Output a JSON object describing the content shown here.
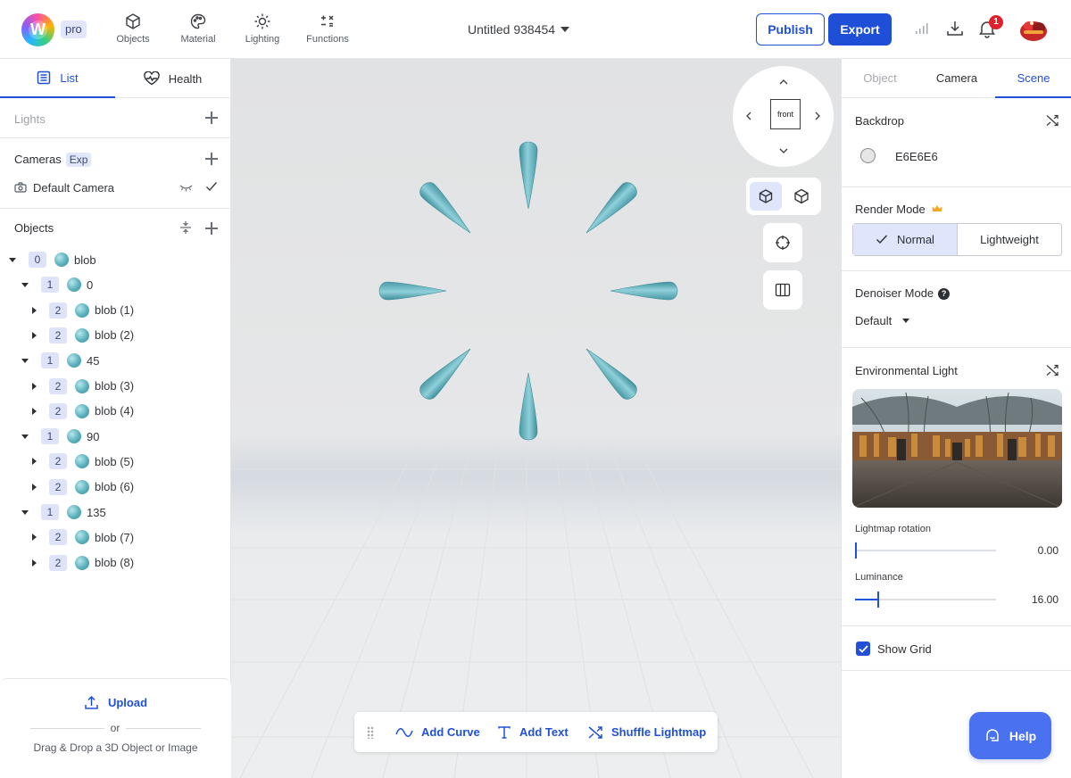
{
  "app": {
    "plan_badge": "pro",
    "logo_letter": "W",
    "document_title": "Untitled 938454"
  },
  "toolbar": {
    "tools": [
      {
        "label": "Objects",
        "icon": "cube-icon"
      },
      {
        "label": "Material",
        "icon": "palette-icon"
      },
      {
        "label": "Lighting",
        "icon": "sun-icon"
      },
      {
        "label": "Functions",
        "icon": "functions-icon"
      }
    ],
    "publish_label": "Publish",
    "export_label": "Export",
    "notification_count": "1"
  },
  "left_panel": {
    "tabs": [
      {
        "label": "List",
        "icon": "list-icon",
        "active": true
      },
      {
        "label": "Health",
        "icon": "heart-pulse-icon",
        "active": false
      }
    ],
    "lights_label": "Lights",
    "cameras_label": "Cameras",
    "cameras_badge": "Exp",
    "default_camera": "Default Camera",
    "objects_label": "Objects",
    "tree": [
      {
        "level": "0",
        "name": "blob",
        "expanded": true
      },
      {
        "level": "1",
        "name": "0",
        "expanded": true
      },
      {
        "level": "2",
        "name": "blob (1)",
        "expanded": false
      },
      {
        "level": "2",
        "name": "blob (2)",
        "expanded": false
      },
      {
        "level": "1",
        "name": "45",
        "expanded": true
      },
      {
        "level": "2",
        "name": "blob (3)",
        "expanded": false
      },
      {
        "level": "2",
        "name": "blob (4)",
        "expanded": false
      },
      {
        "level": "1",
        "name": "90",
        "expanded": true
      },
      {
        "level": "2",
        "name": "blob (5)",
        "expanded": false
      },
      {
        "level": "2",
        "name": "blob (6)",
        "expanded": false
      },
      {
        "level": "1",
        "name": "135",
        "expanded": true
      },
      {
        "level": "2",
        "name": "blob (7)",
        "expanded": false
      },
      {
        "level": "2",
        "name": "blob (8)",
        "expanded": false
      }
    ],
    "upload_label": "Upload",
    "or_label": "or",
    "drop_label": "Drag & Drop a 3D Object or Image"
  },
  "viewport": {
    "view_label": "front",
    "bottom_actions": [
      {
        "label": "Add Curve",
        "icon": "curve-icon"
      },
      {
        "label": "Add Text",
        "icon": "text-icon"
      },
      {
        "label": "Shuffle Lightmap",
        "icon": "shuffle-icon"
      }
    ],
    "background_color": "#E6E6E6",
    "object_color": "#6FB8C4"
  },
  "right_panel": {
    "tabs": [
      {
        "label": "Object",
        "state": "disabled"
      },
      {
        "label": "Camera",
        "state": "normal"
      },
      {
        "label": "Scene",
        "state": "active"
      }
    ],
    "backdrop_label": "Backdrop",
    "backdrop_value": "E6E6E6",
    "render_mode_label": "Render Mode",
    "render_modes": [
      "Normal",
      "Lightweight"
    ],
    "render_mode_selected": "Normal",
    "denoiser_label": "Denoiser Mode",
    "denoiser_value": "Default",
    "env_light_label": "Environmental Light",
    "lightmap_rotation_label": "Lightmap rotation",
    "lightmap_rotation_value": "0.00",
    "lightmap_rotation_fraction": 0.0,
    "luminance_label": "Luminance",
    "luminance_value": "16.00",
    "luminance_fraction": 0.16,
    "show_grid_label": "Show Grid",
    "show_grid_checked": true,
    "help_label": "Help"
  },
  "colors": {
    "accent": "#2050D8",
    "badge_bg": "#E2E6FB",
    "notification": "#E0202A"
  }
}
